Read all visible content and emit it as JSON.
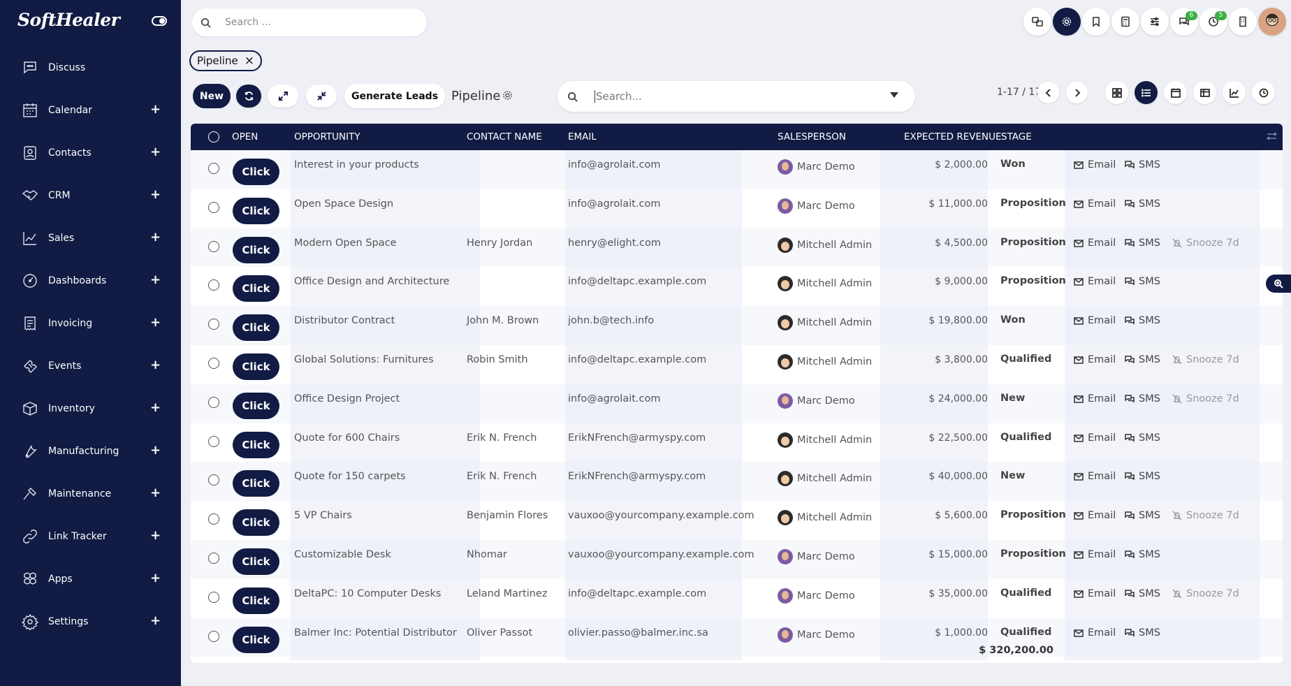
{
  "app": {
    "logo": "SoftHealer"
  },
  "sidebar": {
    "items": [
      {
        "label": "Discuss",
        "icon": "chat-icon",
        "plus": ""
      },
      {
        "label": "Calendar",
        "icon": "calendar-icon",
        "plus": "+"
      },
      {
        "label": "Contacts",
        "icon": "contact-icon",
        "plus": "+"
      },
      {
        "label": "CRM",
        "icon": "handshake-icon",
        "plus": "+"
      },
      {
        "label": "Sales",
        "icon": "chart-line-icon",
        "plus": "+"
      },
      {
        "label": "Dashboards",
        "icon": "gauge-icon",
        "plus": "+"
      },
      {
        "label": "Invoicing",
        "icon": "invoice-icon",
        "plus": "+"
      },
      {
        "label": "Events",
        "icon": "ticket-icon",
        "plus": "+"
      },
      {
        "label": "Inventory",
        "icon": "box-icon",
        "plus": "+"
      },
      {
        "label": "Manufacturing",
        "icon": "wrench-icon",
        "plus": "+"
      },
      {
        "label": "Maintenance",
        "icon": "hammer-icon",
        "plus": "+"
      },
      {
        "label": "Link Tracker",
        "icon": "link-icon",
        "plus": "+"
      },
      {
        "label": "Apps",
        "icon": "cubes-icon",
        "plus": "+"
      },
      {
        "label": "Settings",
        "icon": "gear-icon",
        "plus": "+"
      }
    ]
  },
  "topbar": {
    "search_placeholder": "Search ...",
    "badges": {
      "messages": "6",
      "activities": "5"
    }
  },
  "breadcrumb": {
    "label": "Pipeline",
    "close": "×"
  },
  "controls": {
    "new_label": "New",
    "generate_label": "Generate Leads",
    "view_title": "Pipeline",
    "search_placeholder": "Search...",
    "pager": "1-17 / 17"
  },
  "table": {
    "headers": {
      "open": "OPEN",
      "opportunity": "OPPORTUNITY",
      "contact": "CONTACT NAME",
      "email": "EMAIL",
      "salesperson": "SALESPERSON",
      "revenue": "EXPECTED REVENUE",
      "stage": "STAGE"
    },
    "click_label": "Click",
    "email_action": "Email",
    "sms_action": "SMS",
    "snooze_action": "Snooze 7d",
    "rows": [
      {
        "opportunity": "Interest in your products",
        "contact": "",
        "email": "info@agrolait.com",
        "salesperson": "Marc Demo",
        "avatar": "marc",
        "revenue": "$ 2,000.00",
        "stage": "Won",
        "snooze": false
      },
      {
        "opportunity": "Open Space Design",
        "contact": "",
        "email": "info@agrolait.com",
        "salesperson": "Marc Demo",
        "avatar": "marc",
        "revenue": "$ 11,000.00",
        "stage": "Proposition",
        "snooze": false
      },
      {
        "opportunity": "Modern Open Space",
        "contact": "Henry Jordan",
        "email": "henry@elight.com",
        "salesperson": "Mitchell Admin",
        "avatar": "mitch",
        "revenue": "$ 4,500.00",
        "stage": "Proposition",
        "snooze": true
      },
      {
        "opportunity": "Office Design and Architecture",
        "contact": "",
        "email": "info@deltapc.example.com",
        "salesperson": "Mitchell Admin",
        "avatar": "mitch",
        "revenue": "$ 9,000.00",
        "stage": "Proposition",
        "snooze": false
      },
      {
        "opportunity": "Distributor Contract",
        "contact": "John M. Brown",
        "email": "john.b@tech.info",
        "salesperson": "Mitchell Admin",
        "avatar": "mitch",
        "revenue": "$ 19,800.00",
        "stage": "Won",
        "snooze": false
      },
      {
        "opportunity": "Global Solutions: Furnitures",
        "contact": "Robin Smith",
        "email": "info@deltapc.example.com",
        "salesperson": "Mitchell Admin",
        "avatar": "mitch",
        "revenue": "$ 3,800.00",
        "stage": "Qualified",
        "snooze": true
      },
      {
        "opportunity": "Office Design Project",
        "contact": "",
        "email": "info@agrolait.com",
        "salesperson": "Marc Demo",
        "avatar": "marc",
        "revenue": "$ 24,000.00",
        "stage": "New",
        "snooze": true
      },
      {
        "opportunity": "Quote for 600 Chairs",
        "contact": "Erik N. French",
        "email": "ErikNFrench@armyspy.com",
        "salesperson": "Mitchell Admin",
        "avatar": "mitch",
        "revenue": "$ 22,500.00",
        "stage": "Qualified",
        "snooze": false
      },
      {
        "opportunity": "Quote for 150 carpets",
        "contact": "Erik N. French",
        "email": "ErikNFrench@armyspy.com",
        "salesperson": "Mitchell Admin",
        "avatar": "mitch",
        "revenue": "$ 40,000.00",
        "stage": "New",
        "snooze": false
      },
      {
        "opportunity": "5 VP Chairs",
        "contact": "Benjamin Flores",
        "email": "vauxoo@yourcompany.example.com",
        "salesperson": "Mitchell Admin",
        "avatar": "mitch",
        "revenue": "$ 5,600.00",
        "stage": "Proposition",
        "snooze": true
      },
      {
        "opportunity": "Customizable Desk",
        "contact": "Nhomar",
        "email": "vauxoo@yourcompany.example.com",
        "salesperson": "Marc Demo",
        "avatar": "marc",
        "revenue": "$ 15,000.00",
        "stage": "Proposition",
        "snooze": false
      },
      {
        "opportunity": "DeltaPC: 10 Computer Desks",
        "contact": "Leland Martinez",
        "email": "info@deltapc.example.com",
        "salesperson": "Marc Demo",
        "avatar": "marc",
        "revenue": "$ 35,000.00",
        "stage": "Qualified",
        "snooze": true
      },
      {
        "opportunity": "Balmer Inc: Potential Distributor",
        "contact": "Oliver Passot",
        "email": "olivier.passo@balmer.inc.sa",
        "salesperson": "Marc Demo",
        "avatar": "marc",
        "revenue": "$ 1,000.00",
        "stage": "Qualified",
        "snooze": false
      }
    ],
    "total": "$ 320,200.00"
  },
  "colors": {
    "navy": "#111b43",
    "badge_green": "#3cb043",
    "page_bg": "#eef0f6"
  }
}
